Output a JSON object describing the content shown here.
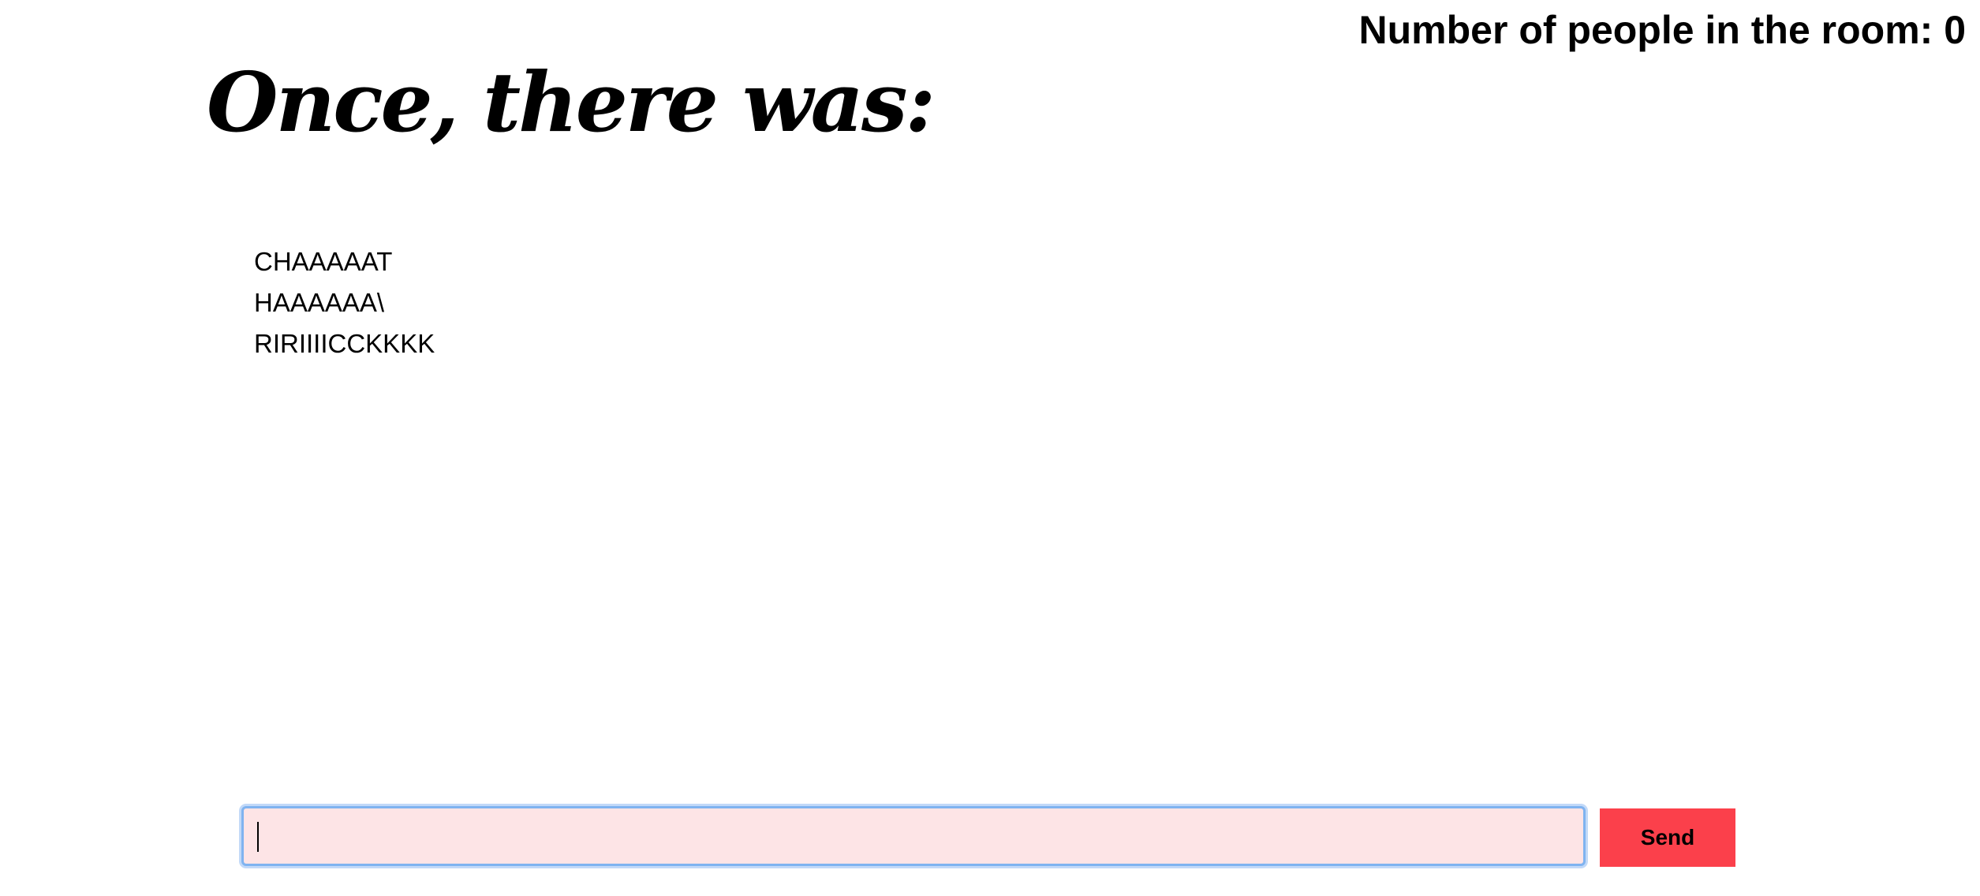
{
  "header": {
    "room_count_text": "Number of people in the room: 0"
  },
  "story": {
    "title": "Once, there was:",
    "messages": [
      "CHAAAAAT",
      "HAAAAAA\\",
      "RIRIIIICCKKKK"
    ]
  },
  "composer": {
    "input_value": "",
    "send_label": "Send"
  },
  "colors": {
    "input_background": "#fde4e6",
    "input_focus_border": "#7fb3f0",
    "send_button": "#fb404b"
  }
}
